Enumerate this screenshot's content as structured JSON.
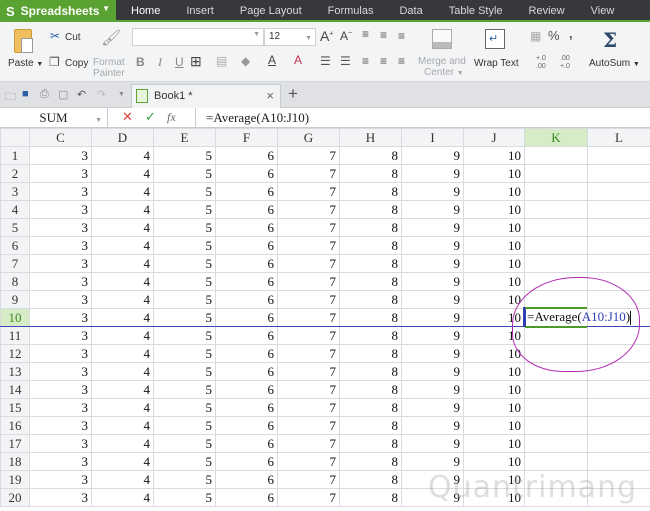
{
  "app": {
    "name": "Spreadsheets",
    "logo": "S"
  },
  "menu": {
    "tabs": [
      {
        "label": "Home",
        "active": true
      },
      {
        "label": "Insert"
      },
      {
        "label": "Page Layout"
      },
      {
        "label": "Formulas"
      },
      {
        "label": "Data"
      },
      {
        "label": "Table Style"
      },
      {
        "label": "Review"
      },
      {
        "label": "View"
      }
    ]
  },
  "ribbon": {
    "paste": "Paste",
    "cut": "Cut",
    "copy": "Copy",
    "format_painter_1": "Format",
    "format_painter_2": "Painter",
    "font_name": "",
    "font_size": "12",
    "bold": "B",
    "italic": "I",
    "underline": "U",
    "grow_font": "A",
    "shrink_font": "A",
    "merge_1": "Merge and",
    "merge_2": "Center",
    "wrap_text": "Wrap Text",
    "percent": "%",
    "comma": ",",
    "inc_decimal": "+.0\n.00",
    "dec_decimal": ".00\n+.0",
    "autosum": "AutoSum",
    "sigma": "Σ"
  },
  "tabstrip": {
    "document": "Book1 *",
    "close": "×",
    "new_tab": "+"
  },
  "formula_bar": {
    "name_box": "SUM",
    "cancel": "✕",
    "confirm": "✓",
    "fx": "fx",
    "formula": "=Average(A10:J10)"
  },
  "grid": {
    "columns": [
      "C",
      "D",
      "E",
      "F",
      "G",
      "H",
      "I",
      "J",
      "K",
      "L"
    ],
    "selected_column": "K",
    "selected_row": 10,
    "row_values": [
      3,
      4,
      5,
      6,
      7,
      8,
      9,
      10
    ],
    "rows": [
      1,
      2,
      3,
      4,
      5,
      6,
      7,
      8,
      9,
      10,
      11,
      12,
      13,
      14,
      15,
      16,
      17,
      18,
      19,
      20
    ],
    "editing_cell": {
      "ref": "K10",
      "prefix": "=Average(",
      "range": "A10:J10",
      "suffix": ")"
    }
  },
  "watermark": "Quantrimang"
}
